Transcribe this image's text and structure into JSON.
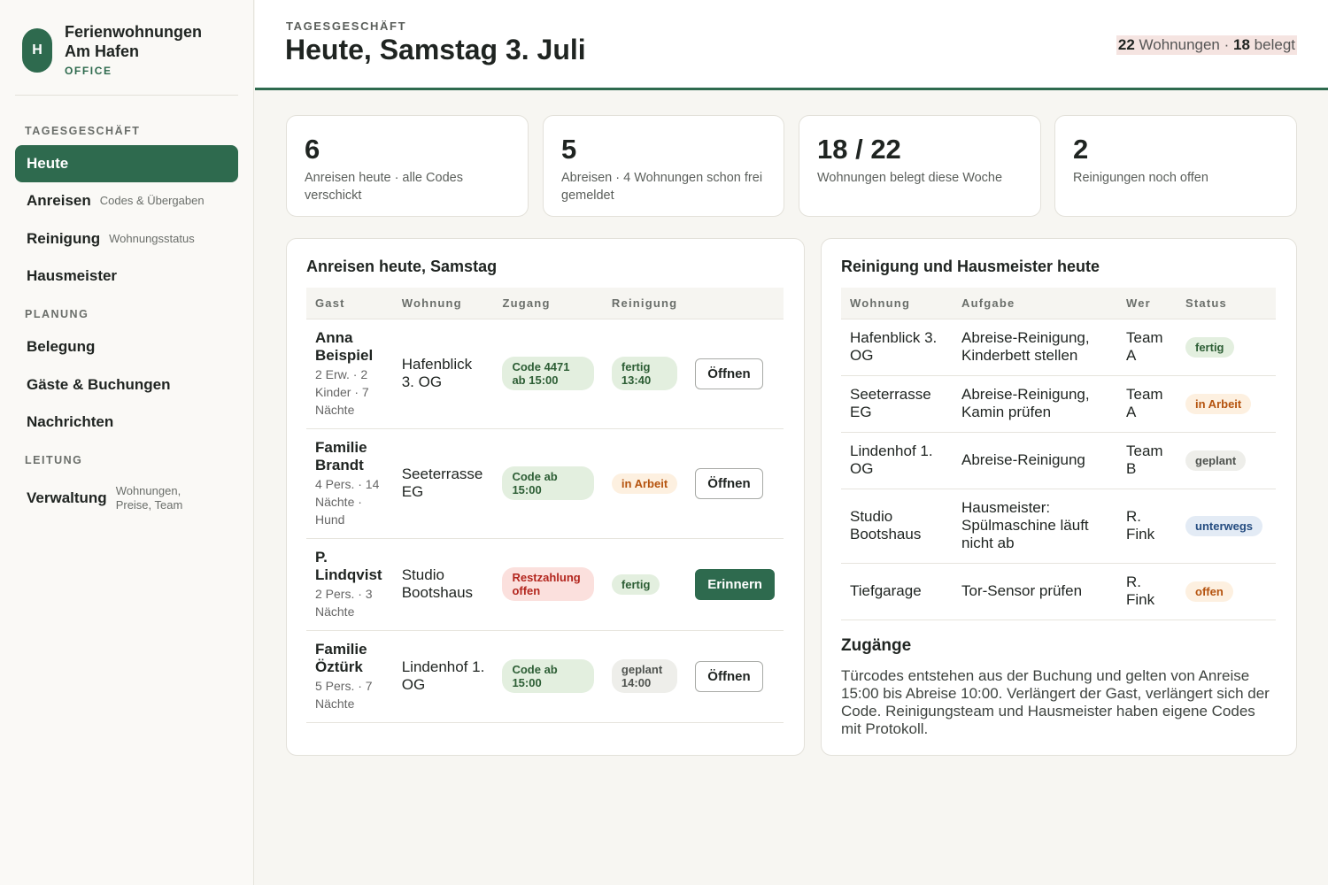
{
  "brand": {
    "logo_letter": "H",
    "name": "Ferienwohnungen Am Hafen",
    "sub": "OFFICE"
  },
  "nav": {
    "sections": [
      "TAGESGESCHÄFT",
      "PLANUNG",
      "LEITUNG"
    ],
    "items": [
      {
        "label": "Heute",
        "sub": "",
        "active": true
      },
      {
        "label": "Anreisen",
        "sub": "Codes & Übergaben"
      },
      {
        "label": "Reinigung",
        "sub": "Wohnungsstatus"
      },
      {
        "label": "Hausmeister",
        "sub": ""
      },
      {
        "label": "Belegung",
        "sub": ""
      },
      {
        "label": "Gäste & Buchungen",
        "sub": ""
      },
      {
        "label": "Nachrichten",
        "sub": ""
      },
      {
        "label": "Verwaltung",
        "sub": "Wohnungen, Preise, Team"
      }
    ]
  },
  "header": {
    "eyebrow": "TAGESGESCHÄFT",
    "title": "Heute, Samstag 3. Juli",
    "occ_total": "22",
    "occ_total_label": "Wohnungen ·",
    "occ_booked": "18",
    "occ_booked_label": "belegt"
  },
  "stats": [
    {
      "num": "6",
      "desc": "Anreisen heute · alle Codes verschickt"
    },
    {
      "num": "5",
      "desc": "Abreisen · 4 Wohnungen schon frei gemeldet"
    },
    {
      "num": "18 / 22",
      "desc": "Wohnungen belegt diese Woche"
    },
    {
      "num": "2",
      "desc": "Reinigungen noch offen"
    }
  ],
  "arrivals": {
    "title": "Anreisen heute, Samstag",
    "columns": [
      "Gast",
      "Wohnung",
      "Zugang",
      "Reinigung",
      ""
    ],
    "rows": [
      {
        "guest": "Anna Beispiel",
        "meta": "2 Erw. · 2 Kinder · 7 Nächte",
        "flat": "Hafenblick 3. OG",
        "access": "Code 4471 ab 15:00",
        "access_status": "green",
        "cleaning": "fertig 13:40",
        "cleaning_status": "green",
        "action": "Öffnen"
      },
      {
        "guest": "Familie Brandt",
        "meta": "4 Pers. · 14 Nächte · Hund",
        "flat": "Seeterrasse EG",
        "access": "Code ab 15:00",
        "access_status": "green",
        "cleaning": "in Arbeit",
        "cleaning_status": "orange",
        "action": "Öffnen"
      },
      {
        "guest": "P. Lindqvist",
        "meta": "2 Pers. · 3 Nächte",
        "flat": "Studio Bootshaus",
        "access": "Restzahlung offen",
        "access_status": "red",
        "cleaning": "fertig",
        "cleaning_status": "green",
        "action": "Erinnern"
      },
      {
        "guest": "Familie Öztürk",
        "meta": "5 Pers. · 7 Nächte",
        "flat": "Lindenhof 1. OG",
        "access": "Code ab 15:00",
        "access_status": "green",
        "cleaning": "geplant 14:00",
        "cleaning_status": "gray",
        "action": "Öffnen"
      }
    ]
  },
  "tasks": {
    "title": "Reinigung und Hausmeister heute",
    "columns": [
      "Wohnung",
      "Aufgabe",
      "Wer",
      "Status"
    ],
    "rows": [
      {
        "flat": "Hafenblick 3. OG",
        "task": "Abreise-Reinigung, Kinderbett stellen",
        "who": "Team A",
        "status": "fertig",
        "status_color": "green"
      },
      {
        "flat": "Seeterrasse EG",
        "task": "Abreise-Reinigung, Kamin prüfen",
        "who": "Team A",
        "status": "in Arbeit",
        "status_color": "orange"
      },
      {
        "flat": "Lindenhof 1. OG",
        "task": "Abreise-Reinigung",
        "who": "Team B",
        "status": "geplant",
        "status_color": "gray"
      },
      {
        "flat": "Studio Bootshaus",
        "task": "Hausmeister: Spülmaschine läuft nicht ab",
        "who": "R. Fink",
        "status": "unterwegs",
        "status_color": "blue"
      },
      {
        "flat": "Tiefgarage",
        "task": "Tor-Sensor prüfen",
        "who": "R. Fink",
        "status": "offen",
        "status_color": "orange"
      }
    ]
  },
  "access": {
    "title": "Zugänge",
    "text": "Türcodes entstehen aus der Buchung und gelten von Anreise 15:00 bis Abreise 10:00. Verlängert der Gast, verlängert sich der Code. Reinigungsteam und Hausmeister haben eigene Codes mit Protokoll."
  }
}
